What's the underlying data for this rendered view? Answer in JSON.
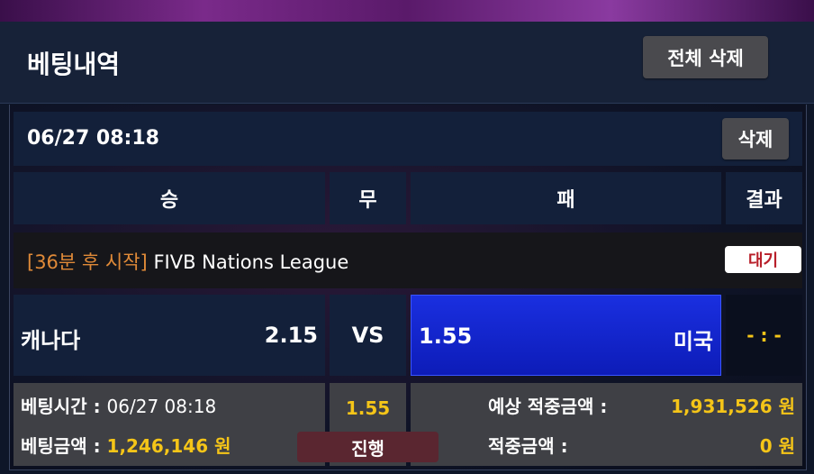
{
  "header": {
    "title": "베팅내역",
    "delete_all_label": "전체 삭제"
  },
  "bet": {
    "datetime": "06/27 08:18",
    "delete_label": "삭제",
    "columns": {
      "win": "승",
      "draw": "무",
      "lose": "패",
      "result": "결과"
    },
    "league": {
      "prefix": "[36분 후 시작]",
      "name": "FIVB Nations League"
    },
    "status_badge": "대기",
    "home": {
      "name": "캐나다",
      "odds": "2.15"
    },
    "vs_label": "VS",
    "away": {
      "odds": "1.55",
      "name": "미국"
    },
    "result_value": "- : -",
    "selected_odds": "1.55",
    "progress_label": "진행",
    "info": {
      "bet_time_label": "베팅시간 :",
      "bet_time_value": "06/27 08:18",
      "bet_amount_label": "베팅금액 :",
      "bet_amount_value": "1,246,146 원",
      "expected_label": "예상 적중금액 :",
      "expected_value": "1,931,526 원",
      "hit_label": "적중금액 :",
      "hit_value": "0 원"
    }
  },
  "colors": {
    "accent_yellow": "#f5c518",
    "accent_orange": "#e08a38",
    "selected_blue": "#1a2fe0",
    "wait_red": "#b8202a"
  }
}
